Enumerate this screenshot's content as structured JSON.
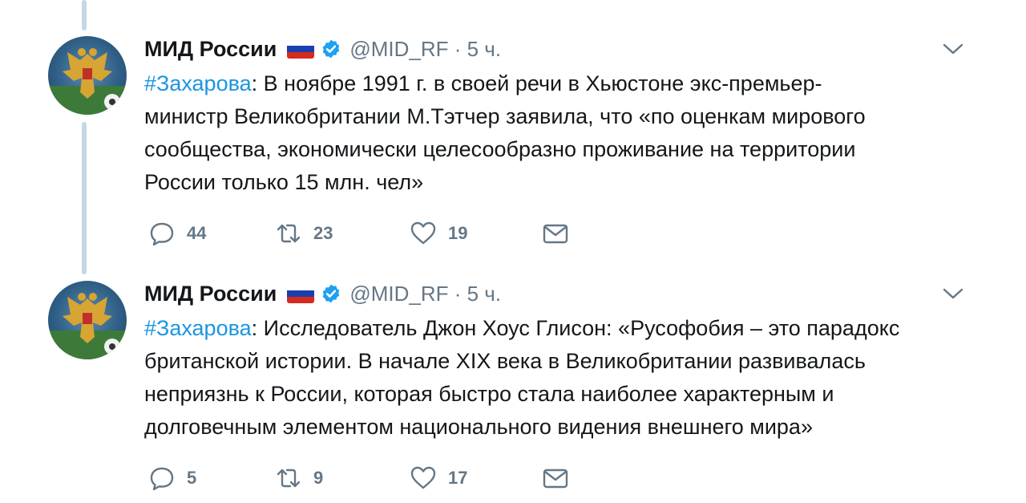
{
  "tweets": [
    {
      "author_name": "МИД России",
      "handle": "@MID_RF",
      "time_sep": " · ",
      "time": "5 ч.",
      "hashtag": "#Захарова",
      "text_lines": [
        ": В ноябре 1991 г. в своей речи в Хьюстоне экс-премьер-",
        "министр Великобритании М.Тэтчер заявила, что «по оценкам мирового",
        "сообщества, экономически целесообразно проживание на территории",
        "России только 15 млн. чел»"
      ],
      "replies": "44",
      "retweets": "23",
      "likes": "19"
    },
    {
      "author_name": "МИД России",
      "handle": "@MID_RF",
      "time_sep": " · ",
      "time": "5 ч.",
      "hashtag": "#Захарова",
      "text_lines": [
        ": Исследователь Джон Хоус Глисон: «Русофобия – это парадокс",
        "британской истории. В начале XIX века в Великобритании развивалась",
        "неприязнь к России, которая быстро стала наиболее характерным и",
        "долговечным элементом национального видения внешнего мира»"
      ],
      "replies": "5",
      "retweets": "9",
      "likes": "17"
    }
  ],
  "icons": {
    "flag": "russia-flag-icon",
    "verified": "verified-badge-icon",
    "menu": "chevron-down-icon",
    "reply": "reply-icon",
    "retweet": "retweet-icon",
    "like": "heart-icon",
    "message": "direct-message-icon"
  },
  "colors": {
    "link": "#1b95e0",
    "secondary": "#657786",
    "verified": "#1da1f2",
    "thread_line": "#c5d7e6"
  }
}
